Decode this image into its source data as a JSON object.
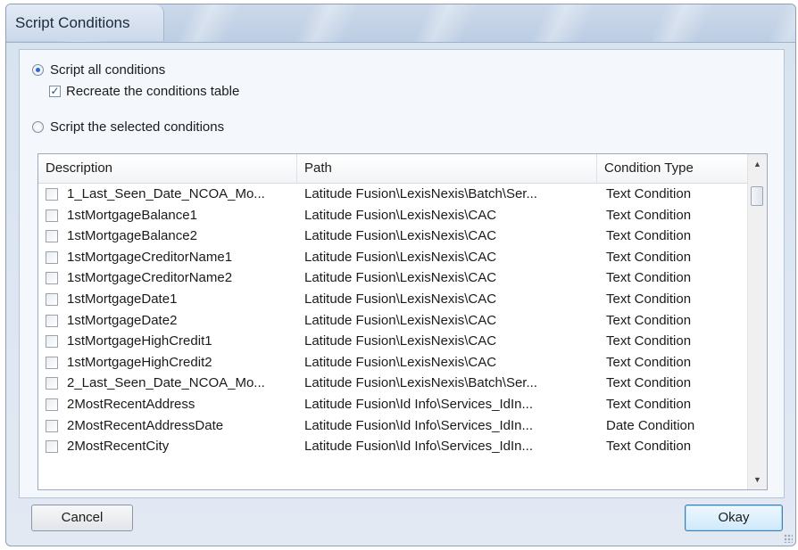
{
  "dialog": {
    "title": "Script Conditions",
    "options": {
      "script_all_label": "Script all conditions",
      "script_all_selected": true,
      "recreate_label": "Recreate the conditions table",
      "recreate_checked": true,
      "script_selected_label": "Script the selected conditions",
      "script_selected_selected": false
    },
    "grid": {
      "columns": [
        "Description",
        "Path",
        "Condition Type"
      ],
      "rows": [
        {
          "description": "1_Last_Seen_Date_NCOA_Mo...",
          "path": "Latitude Fusion\\LexisNexis\\Batch\\Ser...",
          "type": "Text Condition"
        },
        {
          "description": "1stMortgageBalance1",
          "path": "Latitude Fusion\\LexisNexis\\CAC",
          "type": "Text Condition"
        },
        {
          "description": "1stMortgageBalance2",
          "path": "Latitude Fusion\\LexisNexis\\CAC",
          "type": "Text Condition"
        },
        {
          "description": "1stMortgageCreditorName1",
          "path": "Latitude Fusion\\LexisNexis\\CAC",
          "type": "Text Condition"
        },
        {
          "description": "1stMortgageCreditorName2",
          "path": "Latitude Fusion\\LexisNexis\\CAC",
          "type": "Text Condition"
        },
        {
          "description": "1stMortgageDate1",
          "path": "Latitude Fusion\\LexisNexis\\CAC",
          "type": "Text Condition"
        },
        {
          "description": "1stMortgageDate2",
          "path": "Latitude Fusion\\LexisNexis\\CAC",
          "type": "Text Condition"
        },
        {
          "description": "1stMortgageHighCredit1",
          "path": "Latitude Fusion\\LexisNexis\\CAC",
          "type": "Text Condition"
        },
        {
          "description": "1stMortgageHighCredit2",
          "path": "Latitude Fusion\\LexisNexis\\CAC",
          "type": "Text Condition"
        },
        {
          "description": "2_Last_Seen_Date_NCOA_Mo...",
          "path": "Latitude Fusion\\LexisNexis\\Batch\\Ser...",
          "type": "Text Condition"
        },
        {
          "description": "2MostRecentAddress",
          "path": "Latitude Fusion\\Id Info\\Services_IdIn...",
          "type": "Text Condition"
        },
        {
          "description": "2MostRecentAddressDate",
          "path": "Latitude Fusion\\Id Info\\Services_IdIn...",
          "type": "Date Condition"
        },
        {
          "description": "2MostRecentCity",
          "path": "Latitude Fusion\\Id Info\\Services_IdIn...",
          "type": "Text Condition"
        }
      ]
    },
    "buttons": {
      "cancel_label": "Cancel",
      "okay_label": "Okay"
    },
    "icons": {
      "scroll_up": "scroll-up-arrow-icon",
      "scroll_down": "scroll-down-arrow-icon",
      "resize_grip": "resize-grip-icon"
    }
  }
}
